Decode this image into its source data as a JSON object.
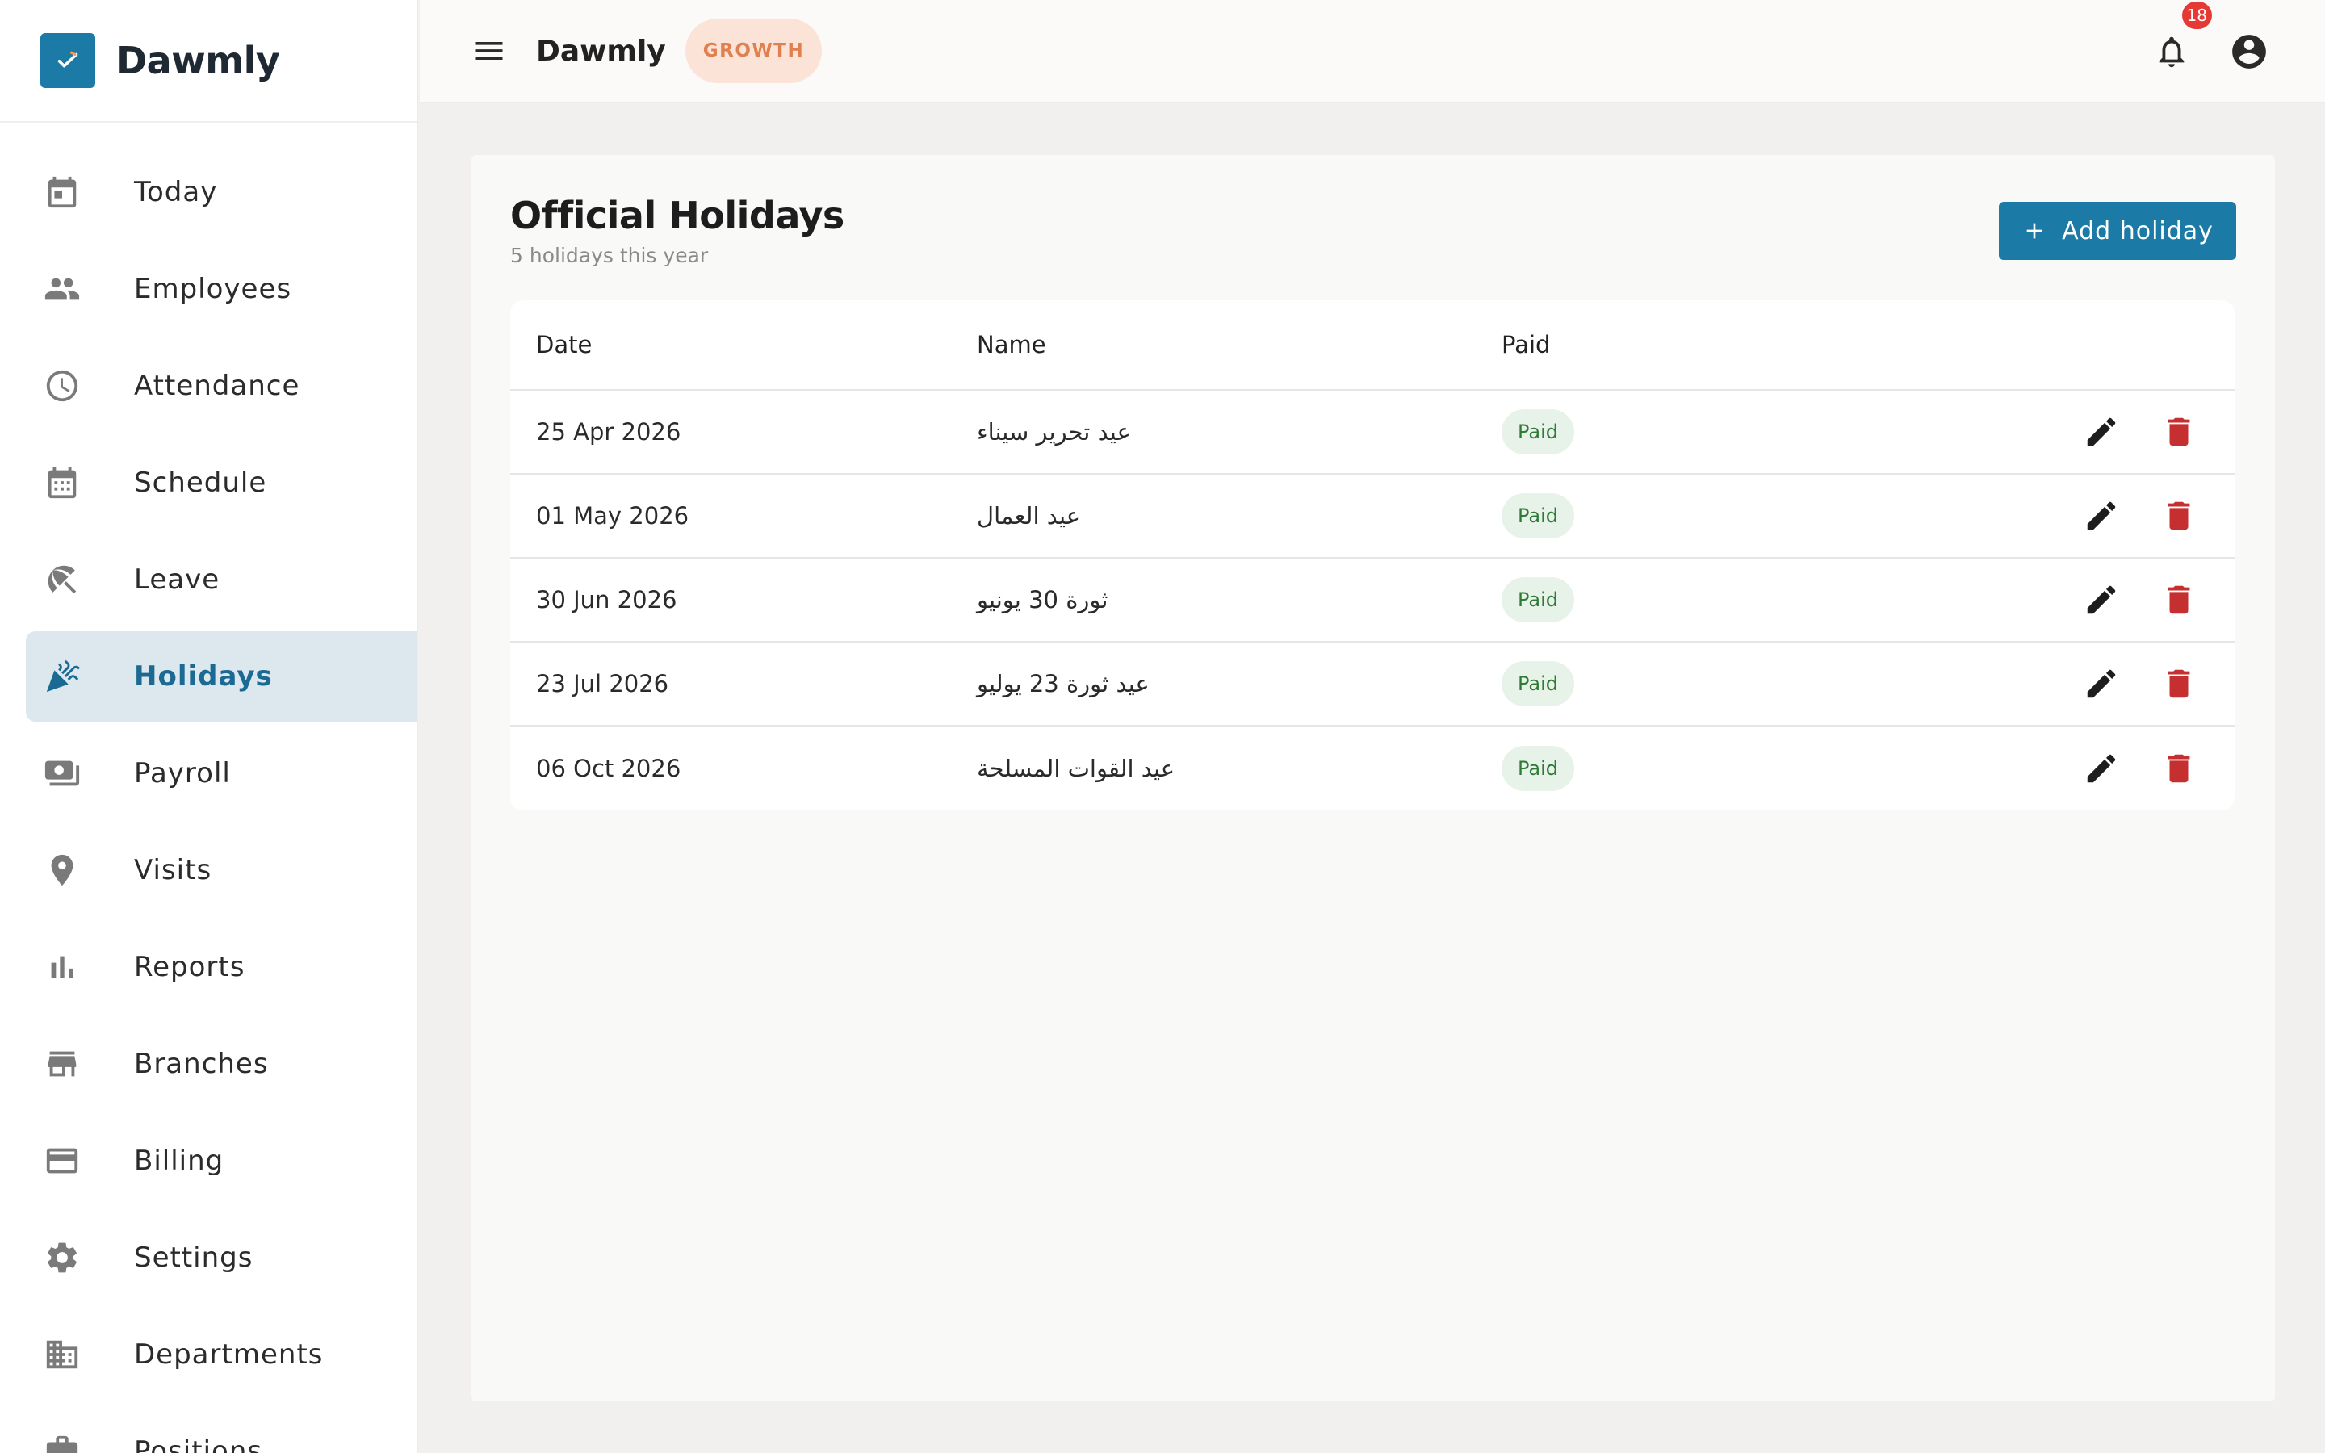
{
  "app": {
    "brand": "Dawmly",
    "brand_color": "#1b7aa6"
  },
  "sidebar": {
    "items": [
      {
        "label": "Today",
        "icon": "calendar-today-icon"
      },
      {
        "label": "Employees",
        "icon": "people-icon"
      },
      {
        "label": "Attendance",
        "icon": "clock-icon"
      },
      {
        "label": "Schedule",
        "icon": "calendar-month-icon"
      },
      {
        "label": "Leave",
        "icon": "beach-umbrella-icon"
      },
      {
        "label": "Holidays",
        "icon": "celebration-icon",
        "active": true
      },
      {
        "label": "Payroll",
        "icon": "payments-icon"
      },
      {
        "label": "Visits",
        "icon": "location-pin-icon"
      },
      {
        "label": "Reports",
        "icon": "bar-chart-icon"
      },
      {
        "label": "Branches",
        "icon": "store-icon"
      },
      {
        "label": "Billing",
        "icon": "credit-card-icon"
      },
      {
        "label": "Settings",
        "icon": "gear-icon"
      },
      {
        "label": "Departments",
        "icon": "building-icon"
      },
      {
        "label": "Positions",
        "icon": "briefcase-icon"
      }
    ]
  },
  "topbar": {
    "title": "Dawmly",
    "plan_badge": "GROWTH",
    "notification_count": "18"
  },
  "page": {
    "title": "Official Holidays",
    "subtitle": "5 holidays this year",
    "add_button_label": "Add holiday"
  },
  "table": {
    "columns": [
      "Date",
      "Name",
      "Paid"
    ],
    "rows": [
      {
        "date": "25 Apr 2026",
        "name": "عيد تحرير سيناء",
        "paid": "Paid"
      },
      {
        "date": "01 May 2026",
        "name": "عيد العمال",
        "paid": "Paid"
      },
      {
        "date": "30 Jun 2026",
        "name": "ثورة 30 يونيو",
        "paid": "Paid"
      },
      {
        "date": "23 Jul 2026",
        "name": "عيد ثورة 23 يوليو",
        "paid": "Paid"
      },
      {
        "date": "06 Oct 2026",
        "name": "عيد القوات المسلحة",
        "paid": "Paid"
      }
    ]
  }
}
